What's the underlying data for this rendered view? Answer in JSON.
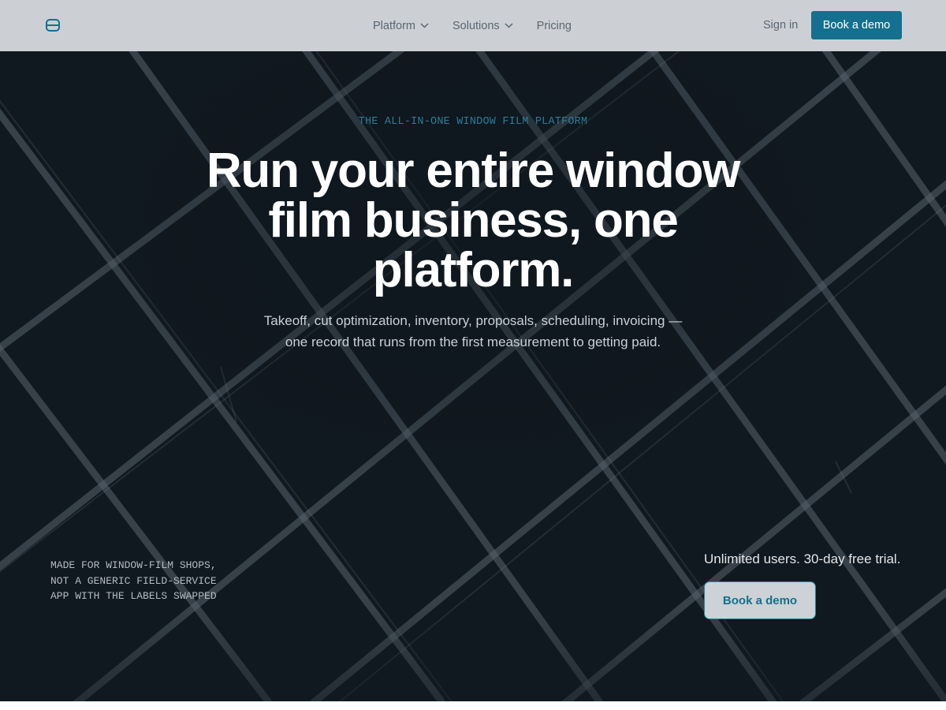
{
  "nav": {
    "logo_icon": "cylinder-logo-icon",
    "links": [
      {
        "label": "Platform",
        "has_dropdown": true
      },
      {
        "label": "Solutions",
        "has_dropdown": true
      },
      {
        "label": "Pricing",
        "has_dropdown": false
      }
    ],
    "sign_in": "Sign in",
    "cta": "Book a demo"
  },
  "hero": {
    "eyebrow": "THE ALL-IN-ONE WINDOW FILM PLATFORM",
    "headline": "Run your entire window film business, one platform.",
    "subtext": "Takeoff, cut optimization, inventory, proposals, scheduling, invoicing — one record that runs from the first measurement to getting paid.",
    "tagline": "MADE FOR WINDOW-FILM SHOPS, NOT A GENERIC FIELD-SERVICE APP WITH THE LABELS SWAPPED",
    "trial": "Unlimited users. 30-day free trial.",
    "cta": "Book a demo"
  },
  "colors": {
    "accent": "#14708e",
    "nav_background": "#ccd0d4",
    "hero_background": "#10191f",
    "eyebrow": "#2d7b99"
  }
}
